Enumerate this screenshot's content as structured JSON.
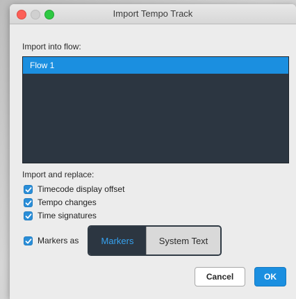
{
  "window": {
    "title": "Import Tempo Track"
  },
  "import_into_flow": {
    "label": "Import into flow:",
    "items": [
      {
        "label": "Flow 1",
        "selected": true
      }
    ]
  },
  "import_and_replace": {
    "label": "Import and replace:",
    "options": [
      {
        "label": "Timecode display offset",
        "checked": true
      },
      {
        "label": "Tempo changes",
        "checked": true
      },
      {
        "label": "Time signatures",
        "checked": true
      }
    ]
  },
  "markers_as": {
    "label": "Markers as",
    "checked": true,
    "segments": [
      {
        "label": "Markers",
        "active": true
      },
      {
        "label": "System Text",
        "active": false
      }
    ]
  },
  "buttons": {
    "cancel": "Cancel",
    "ok": "OK"
  },
  "colors": {
    "accent": "#1b8fe0",
    "list_background": "#2c3641",
    "segment_active_text": "#36a2f0",
    "close_button": "#fc5f57",
    "zoom_button": "#2ec942"
  }
}
